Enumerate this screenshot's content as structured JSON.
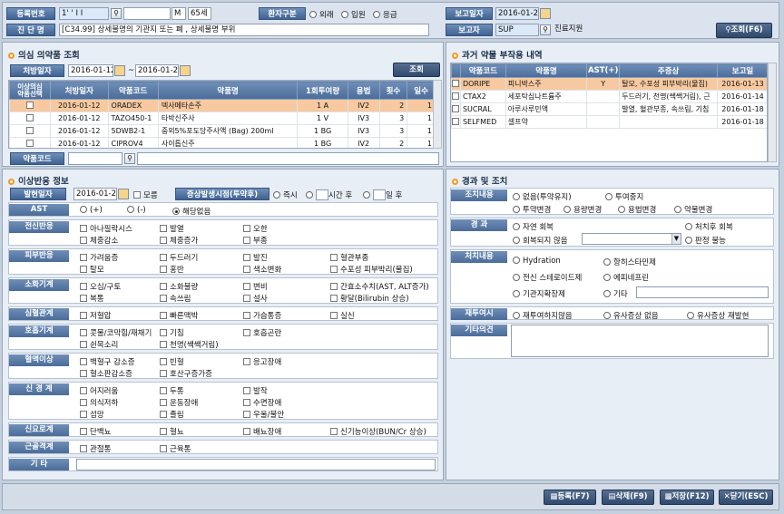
{
  "header": {
    "reg_no_label": "등록번호",
    "reg_no_value": "1' ' I I",
    "patient_name": "",
    "gender": "M",
    "age": "65세",
    "patient_type_label": "환자구분",
    "patient_types": [
      "외래",
      "입원",
      "응급"
    ],
    "report_date_label": "보고일자",
    "report_date": "2016-01-21",
    "diagnosis_label": "진 단 명",
    "diagnosis_value": "[C34.99] 상세불명의 기관지 또는 폐 , 상세불명 부위",
    "reporter_label": "보고자",
    "reporter_value": "SUP",
    "reporter_dept": "진료지원",
    "query_button": "조회(F6)"
  },
  "suspect": {
    "title": "의심 의약품 조회",
    "rx_date_label": "처방일자",
    "date_from": "2016-01-12",
    "tilde": "~",
    "date_to": "2016-01-21",
    "query_button": "조회",
    "columns": [
      "이상의심\n약품선택",
      "처방일자",
      "약품코드",
      "약품명",
      "1회투여량",
      "용법",
      "횟수",
      "일수"
    ],
    "rows": [
      [
        "2016-01-12",
        "ORADEX",
        "덱사메타손주",
        "1 A",
        "IV2",
        "2",
        "1"
      ],
      [
        "2016-01-12",
        "TAZO450-1",
        "타박신주사",
        "1 V",
        "IV3",
        "3",
        "1"
      ],
      [
        "2016-01-12",
        "5DWB2-1",
        "중외5%포도당주사액 (Bag) 200ml",
        "1 BG",
        "IV3",
        "3",
        "1"
      ],
      [
        "2016-01-12",
        "CIPROV4",
        "사이톱신주",
        "1 BG",
        "IV2",
        "2",
        "1"
      ]
    ],
    "drug_code_label": "약품코드"
  },
  "past": {
    "title": "과거 약물 부작용 내역",
    "columns": [
      "약품코드",
      "약품명",
      "AST(+)",
      "주증상",
      "보고일"
    ],
    "rows": [
      [
        "DORIPE",
        "피니박스주",
        "Y",
        "탈모, 수포성 피부박리(물집)",
        "2016-01-13"
      ],
      [
        "CTAX2",
        "세포탁심나트륨주",
        "",
        "두드러기, 천명(쌕쌕거림), 근",
        "2016-01-14"
      ],
      [
        "SUCRAL",
        "아루사루민액",
        "",
        "발열, 혈관부종, 속쓰림, 기침",
        "2016-01-18"
      ],
      [
        "SELFMED",
        "셀프약",
        "",
        "",
        "2016-01-18"
      ]
    ]
  },
  "adverse": {
    "title": "이상반응 정보",
    "onset_label": "발현일자",
    "onset_date": "2016-01-21",
    "unknown": "모름",
    "timing_label": "증상발생시점(투약후)",
    "immediate": "즉시",
    "hours_after": "시간 후",
    "days_after": "일 후",
    "ast_label": "AST",
    "ast_opts": [
      "(+)",
      "(-)",
      "해당없음"
    ],
    "groups": [
      {
        "label": "전신반응",
        "items": [
          "아나필락시스",
          "발열",
          "오한",
          "체중감소",
          "체중증가",
          "부종"
        ]
      },
      {
        "label": "피부반응",
        "items": [
          "가려움증",
          "두드러기",
          "발진",
          "혈관부종",
          "탈모",
          "홍반",
          "색소변화",
          "수포성 피부박리(물집)"
        ]
      },
      {
        "label": "소화기계",
        "items": [
          "오심/구토",
          "소화불량",
          "변비",
          "간효소수치(AST, ALT증가)",
          "복통",
          "속쓰림",
          "설사",
          "황달(Bilirubin 상승)"
        ]
      },
      {
        "label": "심혈관계",
        "items": [
          "저혈압",
          "빠른맥박",
          "가슴통증",
          "실신"
        ]
      },
      {
        "label": "호흡기계",
        "items": [
          "콧물/코막힘/재채기",
          "기침",
          "호흡곤란",
          "쉰목소리",
          "천명(쌕쌕거림)"
        ]
      },
      {
        "label": "혈액이상",
        "items": [
          "백혈구 감소증",
          "빈혈",
          "응고장애",
          "혈소판감소증",
          "호산구증가증"
        ]
      },
      {
        "label": "신 경 계",
        "items": [
          "어지러움",
          "두통",
          "발작",
          "의식저하",
          "운동장애",
          "수면장애",
          "섬망",
          "졸림",
          "우울/불안"
        ]
      },
      {
        "label": "신요로계",
        "items": [
          "단백뇨",
          "혈뇨",
          "배뇨장애",
          "신기능이상(BUN/Cr 상승)"
        ]
      },
      {
        "label": "근골격계",
        "items": [
          "관절통",
          "근육통"
        ]
      },
      {
        "label": "기 타",
        "items": []
      }
    ]
  },
  "outcome": {
    "title": "경과 및 조치",
    "action_label": "조치내용",
    "action_opts": [
      "없음(투약유지)",
      "투여중지",
      "투약변경",
      "용량변경",
      "용법변경",
      "약물변경"
    ],
    "course_label": "경 과",
    "course_opts": [
      "자연 회복",
      "처치후 회복",
      "회복되지 않음",
      "판정 불능"
    ],
    "treat_label": "처치내용",
    "treat_opts": [
      "Hydration",
      "항히스타민제",
      "전신 스테로이드제",
      "에피네프린",
      "기관지확장제",
      "기타"
    ],
    "rechallenge_label": "재투여시",
    "rechallenge_opts": [
      "재투여하지않음",
      "유사증상 없음",
      "유사증상 재발현"
    ],
    "other_label": "기타의견"
  },
  "footer": {
    "register": "등록(F7)",
    "delete": "삭제(F9)",
    "save": "저장(F12)",
    "close": "닫기(ESC)"
  }
}
